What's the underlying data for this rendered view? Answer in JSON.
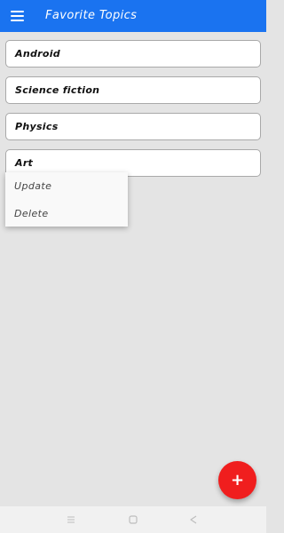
{
  "app_bar": {
    "title": "Favorite Topics",
    "menu_icon": "hamburger-menu-icon",
    "color": "#1a73f0"
  },
  "topics": [
    {
      "label": "Android"
    },
    {
      "label": "Science fiction"
    },
    {
      "label": "Physics"
    },
    {
      "label": "Art"
    }
  ],
  "context_menu": {
    "items": [
      {
        "label": "Update"
      },
      {
        "label": "Delete"
      }
    ]
  },
  "fab": {
    "label": "+",
    "icon": "add-icon",
    "color": "#f01e1e"
  },
  "system_nav": {
    "buttons": [
      "recent-apps-icon",
      "home-icon",
      "back-icon"
    ]
  }
}
